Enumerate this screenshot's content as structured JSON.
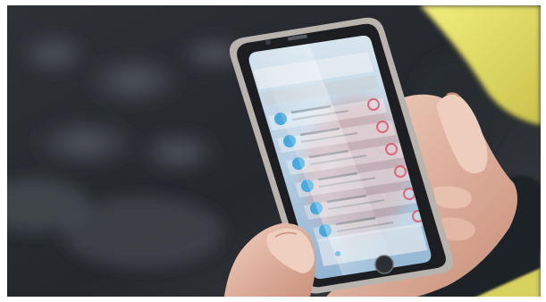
{
  "scene": {
    "subject": "hands-holding-smartphone",
    "app_list_item_count": 6
  },
  "colors": {
    "background_dark": "#1d2024",
    "background_mid": "#3a3e43",
    "yellow_vest": "#e7e46a",
    "yellow_vest_shadow": "#b9b23f",
    "phone_frame": "#b8b2ad",
    "phone_bezel": "#1b1d21",
    "screen_blue": "#a9c6df",
    "app_accent_blue": "#47a9dc",
    "app_accent_red": "#d9475d",
    "skin": "#e9c3b2",
    "skin_shadow": "#c48f79"
  },
  "icons": {
    "list_icon": "circle-icon",
    "action_icon": "ring-icon",
    "home_button": "home-button-icon"
  }
}
